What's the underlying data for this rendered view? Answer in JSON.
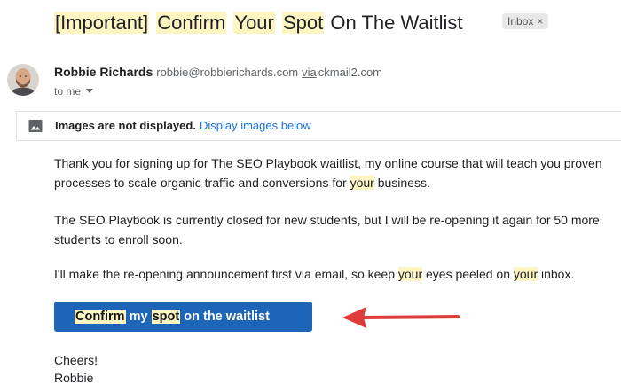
{
  "subject": {
    "parts": [
      {
        "text": "[Important]",
        "highlight": true
      },
      {
        "text": " ",
        "highlight": false
      },
      {
        "text": "Confirm",
        "highlight": true
      },
      {
        "text": " ",
        "highlight": false
      },
      {
        "text": "Your",
        "highlight": true
      },
      {
        "text": " ",
        "highlight": false
      },
      {
        "text": "Spot",
        "highlight": true
      },
      {
        "text": " On The Waitlist",
        "highlight": false
      }
    ],
    "label_chip": "Inbox",
    "label_chip_close": "×"
  },
  "sender": {
    "name": "Robbie Richards",
    "email": "robbie@robbierichards.com",
    "via_label": "via",
    "via_domain": "ckmail2.com",
    "to": "to me"
  },
  "images_bar": {
    "bold_text": "Images are not displayed.",
    "link_text": "Display images below",
    "icon": "image-icon"
  },
  "body": {
    "p1": [
      {
        "text": "Thank you for signing up for The SEO Playbook waitlist, my online course that will teach you proven processes to scale organic traffic and conversions for ",
        "highlight": false
      },
      {
        "text": "your",
        "highlight": true
      },
      {
        "text": " business.",
        "highlight": false
      }
    ],
    "p2": [
      {
        "text": "The SEO Playbook is currently closed for new students, but I will be re-opening it again for 50 more students to enroll soon.",
        "highlight": false
      }
    ],
    "p3": [
      {
        "text": "I'll make the re-opening announcement first via email, so keep ",
        "highlight": false
      },
      {
        "text": "your",
        "highlight": true
      },
      {
        "text": " eyes peeled on ",
        "highlight": false
      },
      {
        "text": "your",
        "highlight": true
      },
      {
        "text": " inbox.",
        "highlight": false
      }
    ]
  },
  "cta": {
    "parts": [
      {
        "text": "Confirm",
        "highlight": true
      },
      {
        "text": " my ",
        "highlight": false
      },
      {
        "text": "spot",
        "highlight": true
      },
      {
        "text": " on the waitlist",
        "highlight": false
      }
    ]
  },
  "signoff": {
    "line1": "Cheers!",
    "line2": "Robbie"
  },
  "colors": {
    "highlight": "#fdf6c3",
    "cta_background": "#1c65b7",
    "arrow": "#e03a3a",
    "link": "#1a73e8"
  }
}
